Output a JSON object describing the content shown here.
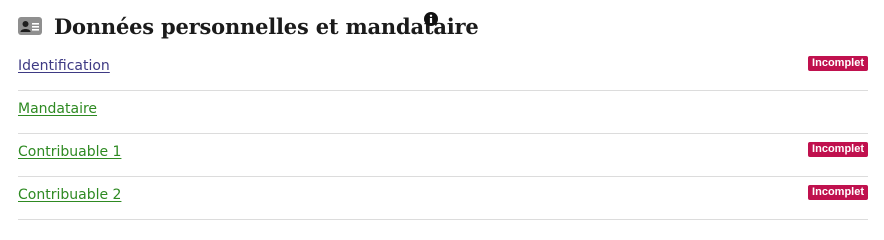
{
  "section": {
    "title": "Données personnelles et mandataire",
    "icon": "id-card-icon",
    "info_icon": "info-icon"
  },
  "items": [
    {
      "label": "Identification",
      "badge": "Incomplet",
      "link_color": "#3e3a84"
    },
    {
      "label": "Mandataire",
      "badge": null,
      "link_color": "#2e8a22"
    },
    {
      "label": "Contribuable 1",
      "badge": "Incomplet",
      "link_color": "#2e8a22"
    },
    {
      "label": "Contribuable 2",
      "badge": "Incomplet",
      "link_color": "#2e8a22"
    }
  ],
  "colors": {
    "badge_bg": "#c0114e",
    "title": "#1b1b1b",
    "divider": "#dcdcdc"
  }
}
